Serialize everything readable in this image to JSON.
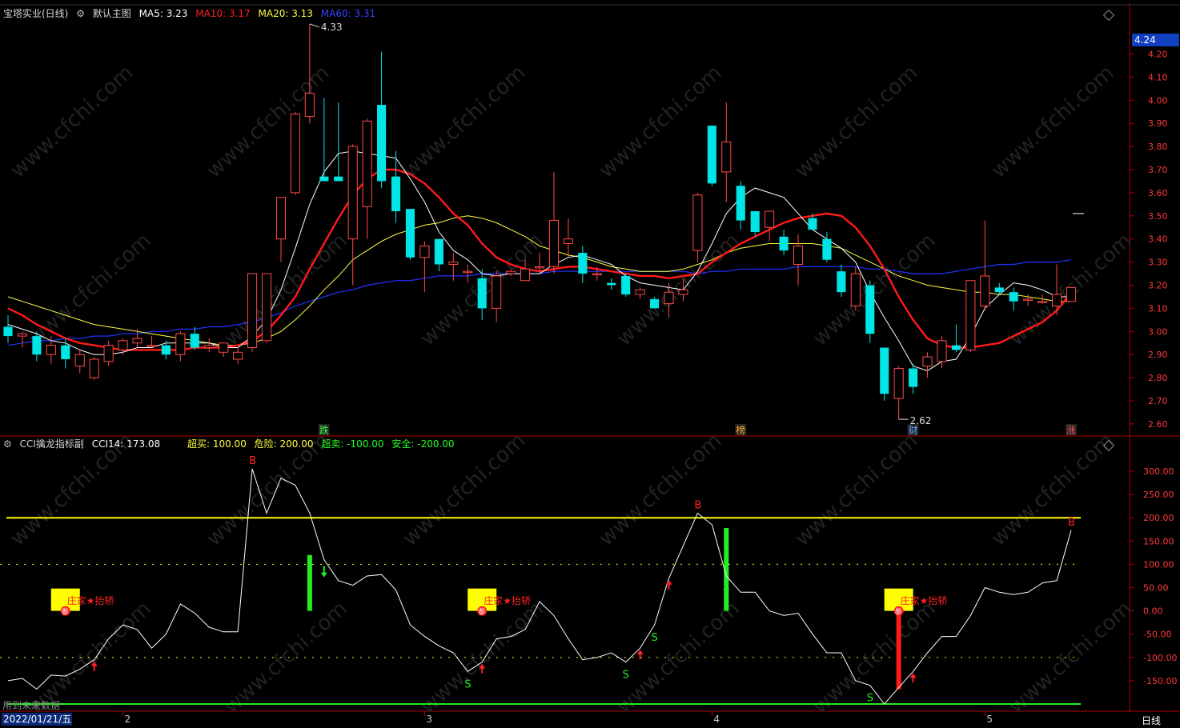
{
  "header": {
    "stock": "宝塔实业(日线)",
    "main_chart_label": "默认主图",
    "ma5": "MA5: 3.23",
    "ma10": "MA10: 3.17",
    "ma20": "MA20: 3.13",
    "ma60": "MA60: 3.31"
  },
  "sub_header": {
    "indicator": "CCI擒龙指标副",
    "cci": "CCI14: 173.08",
    "overbuy": "超买: 100.00",
    "danger": "危险: 200.00",
    "oversell": "超卖: -100.00",
    "safe": "安全: -200.00"
  },
  "price_current": "4.24",
  "annotations": {
    "high": "4.33",
    "low": "2.62",
    "marker_tags": [
      "跌",
      "榜",
      "财",
      "涨"
    ],
    "zhuang_label": "庄家★抬轿",
    "can_label": "参",
    "bottom_left": "用到未来数据"
  },
  "date_axis": {
    "date_box": "2022/01/21/五",
    "labels": [
      "2",
      "3",
      "4",
      "5"
    ],
    "period": "日线"
  },
  "watermark": "www.cfchi.com",
  "colors": {
    "up": "#ff4a4a",
    "down": "#00e5e5",
    "ma5": "#ffffff",
    "ma10": "#ff1a1a",
    "ma20": "#ffff44",
    "ma60": "#2233ff",
    "axis": "#b00000"
  },
  "chart_data": [
    {
      "type": "candlestick",
      "title": "宝塔实业(日线)",
      "ylim": [
        2.58,
        4.3
      ],
      "yticks": [
        "4.20",
        "4.10",
        "4.00",
        "3.90",
        "3.80",
        "3.70",
        "3.60",
        "3.50",
        "3.40",
        "3.30",
        "3.20",
        "3.10",
        "3.00",
        "2.90",
        "2.80",
        "2.70",
        "2.60"
      ],
      "candles": [
        [
          3.02,
          3.07,
          2.95,
          2.98
        ],
        [
          2.98,
          3.0,
          2.93,
          2.99
        ],
        [
          2.98,
          3.0,
          2.87,
          2.9
        ],
        [
          2.9,
          2.98,
          2.86,
          2.94
        ],
        [
          2.94,
          2.97,
          2.84,
          2.88
        ],
        [
          2.85,
          2.92,
          2.82,
          2.9
        ],
        [
          2.8,
          2.89,
          2.79,
          2.88
        ],
        [
          2.87,
          2.96,
          2.85,
          2.94
        ],
        [
          2.92,
          2.97,
          2.9,
          2.96
        ],
        [
          2.95,
          3.01,
          2.93,
          2.97
        ],
        [
          2.94,
          2.98,
          2.93,
          2.94
        ],
        [
          2.94,
          2.96,
          2.88,
          2.9
        ],
        [
          2.9,
          3.0,
          2.87,
          2.99
        ],
        [
          2.99,
          3.02,
          2.92,
          2.93
        ],
        [
          2.93,
          2.97,
          2.91,
          2.94
        ],
        [
          2.91,
          2.95,
          2.89,
          2.95
        ],
        [
          2.88,
          2.93,
          2.86,
          2.91
        ],
        [
          2.93,
          3.25,
          2.91,
          3.25
        ],
        [
          2.96,
          3.25,
          2.95,
          3.25
        ],
        [
          3.4,
          3.58,
          3.3,
          3.58
        ],
        [
          3.6,
          3.95,
          3.59,
          3.94
        ],
        [
          3.93,
          4.33,
          3.9,
          4.03
        ],
        [
          3.67,
          4.01,
          3.66,
          3.65
        ],
        [
          3.67,
          3.99,
          3.65,
          3.65
        ],
        [
          3.4,
          3.81,
          3.2,
          3.8
        ],
        [
          3.54,
          3.92,
          3.4,
          3.91
        ],
        [
          3.98,
          4.21,
          3.62,
          3.65
        ],
        [
          3.67,
          3.78,
          3.47,
          3.52
        ],
        [
          3.53,
          3.53,
          3.31,
          3.32
        ],
        [
          3.32,
          3.39,
          3.17,
          3.37
        ],
        [
          3.4,
          3.4,
          3.26,
          3.29
        ],
        [
          3.29,
          3.34,
          3.22,
          3.3
        ],
        [
          3.26,
          3.29,
          3.21,
          3.26
        ],
        [
          3.23,
          3.27,
          3.05,
          3.1
        ],
        [
          3.1,
          3.26,
          3.04,
          3.24
        ],
        [
          3.25,
          3.27,
          3.24,
          3.26
        ],
        [
          3.22,
          3.31,
          3.22,
          3.27
        ],
        [
          3.28,
          3.34,
          3.25,
          3.28
        ],
        [
          3.28,
          3.69,
          3.25,
          3.48
        ],
        [
          3.38,
          3.49,
          3.32,
          3.4
        ],
        [
          3.34,
          3.37,
          3.21,
          3.25
        ],
        [
          3.25,
          3.28,
          3.22,
          3.25
        ],
        [
          3.21,
          3.23,
          3.18,
          3.2
        ],
        [
          3.24,
          3.25,
          3.15,
          3.16
        ],
        [
          3.16,
          3.19,
          3.14,
          3.18
        ],
        [
          3.14,
          3.15,
          3.1,
          3.1
        ],
        [
          3.12,
          3.21,
          3.06,
          3.17
        ],
        [
          3.16,
          3.23,
          3.13,
          3.18
        ],
        [
          3.35,
          3.6,
          3.3,
          3.59
        ],
        [
          3.89,
          3.89,
          3.63,
          3.64
        ],
        [
          3.69,
          3.99,
          3.56,
          3.82
        ],
        [
          3.63,
          3.65,
          3.44,
          3.48
        ],
        [
          3.52,
          3.52,
          3.41,
          3.43
        ],
        [
          3.45,
          3.52,
          3.39,
          3.52
        ],
        [
          3.41,
          3.44,
          3.33,
          3.35
        ],
        [
          3.29,
          3.42,
          3.2,
          3.37
        ],
        [
          3.49,
          3.51,
          3.44,
          3.44
        ],
        [
          3.4,
          3.43,
          3.3,
          3.31
        ],
        [
          3.26,
          3.29,
          3.15,
          3.17
        ],
        [
          3.11,
          3.28,
          3.09,
          3.25
        ],
        [
          3.2,
          3.22,
          2.95,
          2.99
        ],
        [
          2.93,
          2.93,
          2.7,
          2.73
        ],
        [
          2.71,
          2.85,
          2.62,
          2.84
        ],
        [
          2.84,
          2.86,
          2.73,
          2.76
        ],
        [
          2.85,
          2.91,
          2.8,
          2.89
        ],
        [
          2.87,
          2.98,
          2.84,
          2.96
        ],
        [
          2.94,
          3.03,
          2.91,
          2.92
        ],
        [
          2.92,
          3.22,
          2.91,
          3.22
        ],
        [
          3.11,
          3.48,
          3.09,
          3.24
        ],
        [
          3.19,
          3.21,
          3.16,
          3.17
        ],
        [
          3.17,
          3.19,
          3.09,
          3.13
        ],
        [
          3.14,
          3.16,
          3.11,
          3.14
        ],
        [
          3.13,
          3.16,
          3.12,
          3.13
        ],
        [
          3.11,
          3.29,
          3.07,
          3.16
        ],
        [
          3.13,
          3.19,
          3.13,
          3.19
        ]
      ],
      "ma5": [
        3.03,
        3.01,
        2.99,
        2.96,
        2.95,
        2.92,
        2.9,
        2.9,
        2.91,
        2.93,
        2.93,
        2.95,
        2.95,
        2.95,
        2.95,
        2.93,
        2.93,
        2.98,
        3.05,
        3.18,
        3.36,
        3.55,
        3.69,
        3.77,
        3.78,
        3.77,
        3.76,
        3.75,
        3.66,
        3.56,
        3.43,
        3.35,
        3.31,
        3.25,
        3.24,
        3.25,
        3.25,
        3.25,
        3.29,
        3.32,
        3.33,
        3.31,
        3.29,
        3.24,
        3.21,
        3.2,
        3.19,
        3.18,
        3.26,
        3.38,
        3.51,
        3.58,
        3.62,
        3.6,
        3.58,
        3.51,
        3.44,
        3.4,
        3.36,
        3.3,
        3.17,
        3.06,
        2.96,
        2.85,
        2.83,
        2.87,
        2.88,
        2.98,
        3.1,
        3.16,
        3.21,
        3.2,
        3.18,
        3.15,
        3.15
      ],
      "ma10": [
        3.1,
        3.07,
        3.03,
        3.0,
        2.97,
        2.95,
        2.94,
        2.93,
        2.92,
        2.92,
        2.92,
        2.92,
        2.92,
        2.93,
        2.93,
        2.93,
        2.94,
        2.96,
        3.0,
        3.07,
        3.15,
        3.27,
        3.38,
        3.49,
        3.59,
        3.66,
        3.7,
        3.7,
        3.68,
        3.64,
        3.58,
        3.51,
        3.46,
        3.38,
        3.32,
        3.29,
        3.27,
        3.26,
        3.27,
        3.28,
        3.28,
        3.27,
        3.26,
        3.25,
        3.24,
        3.24,
        3.23,
        3.24,
        3.25,
        3.3,
        3.34,
        3.38,
        3.41,
        3.44,
        3.47,
        3.49,
        3.5,
        3.51,
        3.5,
        3.45,
        3.37,
        3.27,
        3.15,
        3.05,
        2.97,
        2.94,
        2.93,
        2.93,
        2.94,
        2.95,
        2.98,
        3.01,
        3.04,
        3.09,
        3.17
      ],
      "ma20": [
        3.15,
        3.13,
        3.11,
        3.09,
        3.07,
        3.05,
        3.03,
        3.02,
        3.01,
        3.0,
        2.99,
        2.98,
        2.97,
        2.96,
        2.95,
        2.94,
        2.94,
        2.95,
        2.97,
        3.0,
        3.05,
        3.11,
        3.18,
        3.24,
        3.31,
        3.35,
        3.39,
        3.42,
        3.44,
        3.46,
        3.47,
        3.49,
        3.5,
        3.49,
        3.47,
        3.44,
        3.41,
        3.37,
        3.35,
        3.33,
        3.32,
        3.3,
        3.28,
        3.27,
        3.26,
        3.26,
        3.26,
        3.27,
        3.29,
        3.31,
        3.34,
        3.36,
        3.37,
        3.38,
        3.38,
        3.38,
        3.38,
        3.37,
        3.36,
        3.33,
        3.3,
        3.27,
        3.24,
        3.22,
        3.2,
        3.19,
        3.18,
        3.17,
        3.17,
        3.16,
        3.16,
        3.15,
        3.14,
        3.13,
        3.13
      ],
      "ma60": [
        2.94,
        2.95,
        2.96,
        2.96,
        2.97,
        2.97,
        2.98,
        2.98,
        2.99,
        2.99,
        3.0,
        3.0,
        3.01,
        3.01,
        3.02,
        3.02,
        3.03,
        3.04,
        3.06,
        3.08,
        3.11,
        3.13,
        3.15,
        3.17,
        3.18,
        3.2,
        3.21,
        3.22,
        3.22,
        3.23,
        3.24,
        3.24,
        3.24,
        3.25,
        3.25,
        3.25,
        3.25,
        3.25,
        3.26,
        3.26,
        3.26,
        3.26,
        3.26,
        3.26,
        3.26,
        3.26,
        3.26,
        3.26,
        3.25,
        3.26,
        3.26,
        3.27,
        3.27,
        3.27,
        3.27,
        3.28,
        3.28,
        3.28,
        3.28,
        3.28,
        3.27,
        3.27,
        3.26,
        3.25,
        3.25,
        3.25,
        3.26,
        3.27,
        3.28,
        3.29,
        3.29,
        3.3,
        3.3,
        3.3,
        3.31
      ]
    },
    {
      "type": "line",
      "title": "CCI擒龙指标副",
      "ylim": [
        -205,
        335
      ],
      "yticks": [
        "300.00",
        "250.00",
        "200.00",
        "150.00",
        "100.00",
        "50.00",
        "0.00",
        "-50.00",
        "-100.00",
        "-150.00"
      ],
      "levels": {
        "danger": 200,
        "overbuy": 100,
        "oversell": -100,
        "safe": -200
      },
      "cci": [
        -150,
        -145,
        -168,
        -138,
        -140,
        -125,
        -105,
        -60,
        -30,
        -40,
        -80,
        -50,
        15,
        -5,
        -35,
        -45,
        -45,
        305,
        210,
        285,
        270,
        210,
        110,
        65,
        55,
        75,
        78,
        45,
        -30,
        -55,
        -75,
        -90,
        -130,
        -110,
        -60,
        -55,
        -40,
        20,
        -10,
        -60,
        -105,
        -100,
        -90,
        -110,
        -80,
        -30,
        70,
        140,
        210,
        185,
        75,
        40,
        40,
        0,
        -10,
        -5,
        -50,
        -90,
        -90,
        -150,
        -160,
        -200,
        -165,
        -130,
        -90,
        -55,
        -55,
        -10,
        50,
        40,
        35,
        40,
        60,
        65,
        173
      ],
      "b_signals": [
        17,
        48,
        74
      ],
      "s_signals": [
        32,
        43,
        45,
        60
      ],
      "up_arrows": [
        6,
        33,
        44,
        46,
        63
      ],
      "down_arrows": [
        22,
        50
      ]
    }
  ]
}
